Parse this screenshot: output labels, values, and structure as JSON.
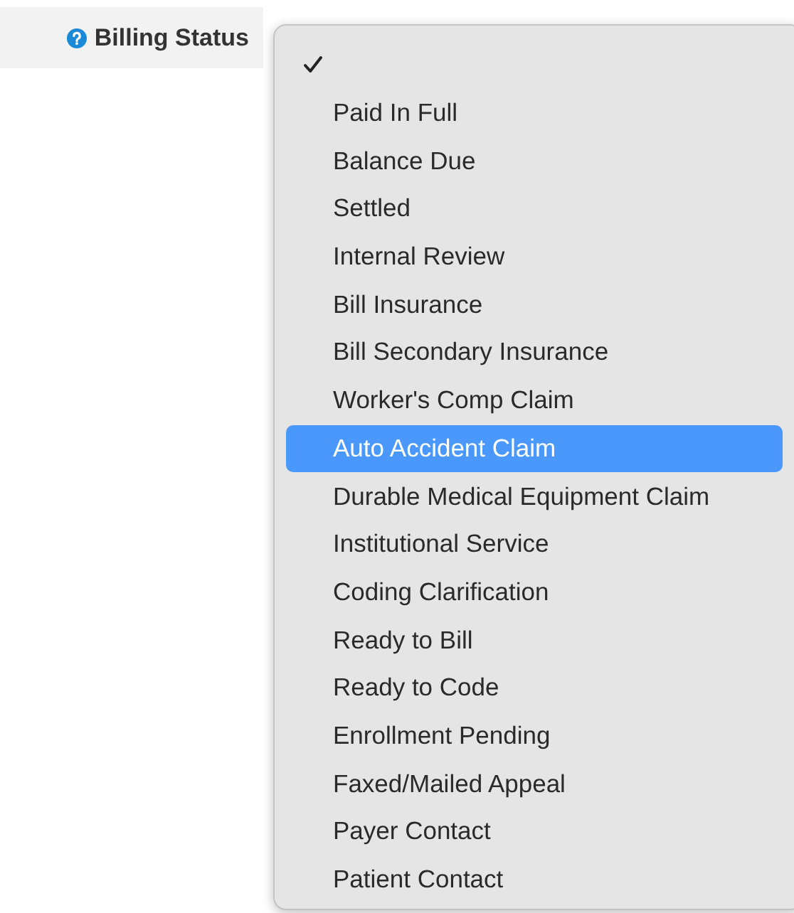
{
  "field": {
    "label": "Billing Status"
  },
  "menu": {
    "items": [
      {
        "checked": true,
        "selected": false
      },
      {
        "label": "Paid In Full",
        "checked": false,
        "selected": false
      },
      {
        "label": "Balance Due",
        "checked": false,
        "selected": false
      },
      {
        "label": "Settled",
        "checked": false,
        "selected": false
      },
      {
        "label": "Internal Review",
        "checked": false,
        "selected": false
      },
      {
        "label": "Bill Insurance",
        "checked": false,
        "selected": false
      },
      {
        "label": "Bill Secondary Insurance",
        "checked": false,
        "selected": false
      },
      {
        "label": "Worker's Comp Claim",
        "checked": false,
        "selected": false
      },
      {
        "label": "Auto Accident Claim",
        "checked": false,
        "selected": true
      },
      {
        "label": "Durable Medical Equipment Claim",
        "checked": false,
        "selected": false
      },
      {
        "label": "Institutional Service",
        "checked": false,
        "selected": false
      },
      {
        "label": "Coding Clarification",
        "checked": false,
        "selected": false
      },
      {
        "label": "Ready to Bill",
        "checked": false,
        "selected": false
      },
      {
        "label": "Ready to Code",
        "checked": false,
        "selected": false
      },
      {
        "label": "Enrollment Pending",
        "checked": false,
        "selected": false
      },
      {
        "label": "Faxed/Mailed Appeal",
        "checked": false,
        "selected": false
      },
      {
        "label": "Payer Contact",
        "checked": false,
        "selected": false
      },
      {
        "label": "Patient Contact",
        "checked": false,
        "selected": false
      }
    ]
  }
}
